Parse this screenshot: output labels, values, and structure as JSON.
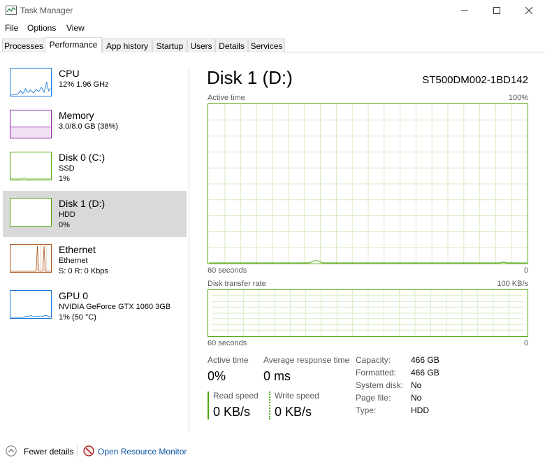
{
  "window": {
    "title": "Task Manager",
    "minimize_icon": "minimize-icon",
    "maximize_icon": "maximize-icon",
    "close_icon": "close-icon"
  },
  "menu": {
    "file": "File",
    "options": "Options",
    "view": "View"
  },
  "tabs": [
    {
      "label": "Processes"
    },
    {
      "label": "Performance"
    },
    {
      "label": "App history"
    },
    {
      "label": "Startup"
    },
    {
      "label": "Users"
    },
    {
      "label": "Details"
    },
    {
      "label": "Services"
    }
  ],
  "sidebar": {
    "cpu": {
      "name": "CPU",
      "line1": "12%  1.96 GHz",
      "color": "#1a7ad6"
    },
    "memory": {
      "name": "Memory",
      "line1": "3.0/8.0 GB (38%)",
      "color": "#8b1aa6"
    },
    "disk0": {
      "name": "Disk 0 (C:)",
      "line1": "SSD",
      "line2": "1%",
      "color": "#4da60c"
    },
    "disk1": {
      "name": "Disk 1 (D:)",
      "line1": "HDD",
      "line2": "0%",
      "color": "#4da60c"
    },
    "ethernet": {
      "name": "Ethernet",
      "line1": "Ethernet",
      "line2": "S: 0  R: 0 Kbps",
      "color": "#a75015"
    },
    "gpu": {
      "name": "GPU 0",
      "line1": "NVIDIA GeForce GTX 1060 3GB",
      "line2": "1%  (50 °C)",
      "color": "#1a7ad6"
    }
  },
  "main": {
    "title": "Disk 1 (D:)",
    "model": "ST500DM002-1BD142",
    "active_time_graph": {
      "label": "Active time",
      "max": "100%",
      "time": "60 seconds",
      "min": "0"
    },
    "transfer_graph": {
      "label": "Disk transfer rate",
      "max": "100 KB/s",
      "time": "60 seconds",
      "min": "0"
    },
    "stats": {
      "active_time_label": "Active time",
      "active_time_value": "0%",
      "avg_response_label": "Average response time",
      "avg_response_value": "0 ms",
      "read_speed_label": "Read speed",
      "read_speed_value": "0 KB/s",
      "write_speed_label": "Write speed",
      "write_speed_value": "0 KB/s"
    },
    "info": {
      "capacity_k": "Capacity:",
      "capacity_v": "466 GB",
      "formatted_k": "Formatted:",
      "formatted_v": "466 GB",
      "system_k": "System disk:",
      "system_v": "No",
      "pagefile_k": "Page file:",
      "pagefile_v": "No",
      "type_k": "Type:",
      "type_v": "HDD"
    }
  },
  "footer": {
    "fewer_details": "Fewer details",
    "resource_monitor": "Open Resource Monitor"
  },
  "colors": {
    "disk_green": "#4da60c",
    "grid_green": "#d7ecc6",
    "selected_bg": "#d9d9d9",
    "link_blue": "#0b57a3"
  }
}
